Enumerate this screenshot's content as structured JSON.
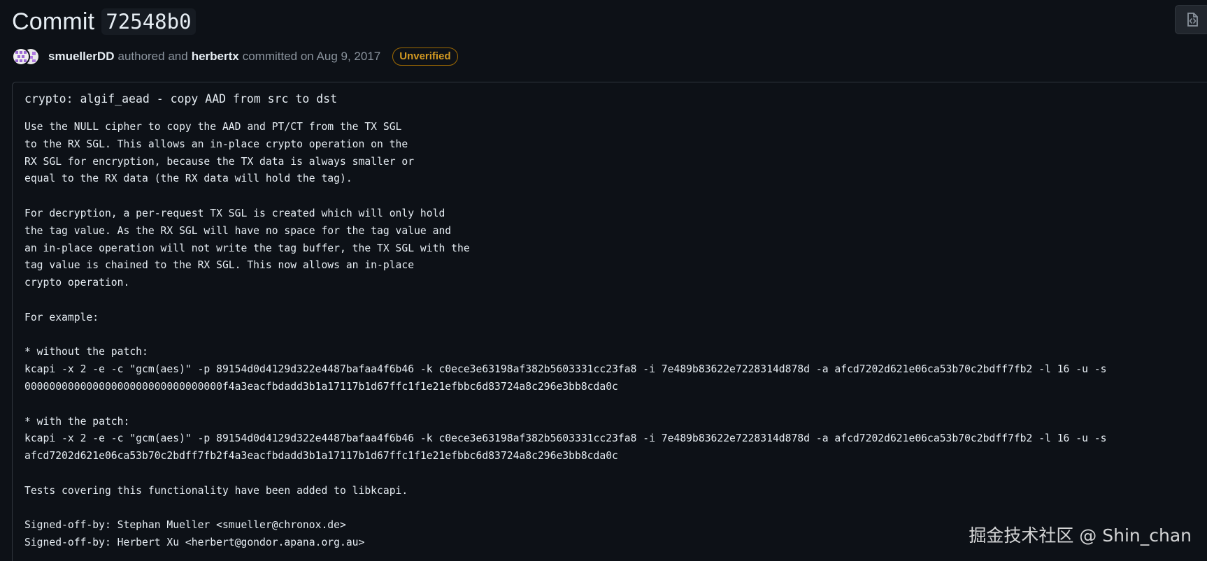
{
  "header": {
    "title": "Commit",
    "sha": "72548b0"
  },
  "meta": {
    "author": "smuellerDD",
    "authored_text": "authored and",
    "committer": "herbertx",
    "committed_text": "committed on Aug 9, 2017",
    "badge": "Unverified"
  },
  "message": {
    "title": "crypto: algif_aead - copy AAD from src to dst",
    "body": "Use the NULL cipher to copy the AAD and PT/CT from the TX SGL\nto the RX SGL. This allows an in-place crypto operation on the\nRX SGL for encryption, because the TX data is always smaller or\nequal to the RX data (the RX data will hold the tag).\n\nFor decryption, a per-request TX SGL is created which will only hold\nthe tag value. As the RX SGL will have no space for the tag value and\nan in-place operation will not write the tag buffer, the TX SGL with the\ntag value is chained to the RX SGL. This now allows an in-place\ncrypto operation.\n\nFor example:\n\n* without the patch:\nkcapi -x 2 -e -c \"gcm(aes)\" -p 89154d0d4129d322e4487bafaa4f6b46 -k c0ece3e63198af382b5603331cc23fa8 -i 7e489b83622e7228314d878d -a afcd7202d621e06ca53b70c2bdff7fb2 -l 16 -u -s\n00000000000000000000000000000000f4a3eacfbdadd3b1a17117b1d67ffc1f1e21efbbc6d83724a8c296e3bb8cda0c\n\n* with the patch:\nkcapi -x 2 -e -c \"gcm(aes)\" -p 89154d0d4129d322e4487bafaa4f6b46 -k c0ece3e63198af382b5603331cc23fa8 -i 7e489b83622e7228314d878d -a afcd7202d621e06ca53b70c2bdff7fb2 -l 16 -u -s\nafcd7202d621e06ca53b70c2bdff7fb2f4a3eacfbdadd3b1a17117b1d67ffc1f1e21efbbc6d83724a8c296e3bb8cda0c\n\nTests covering this functionality have been added to libkcapi.\n\nSigned-off-by: Stephan Mueller <smueller@chronox.de>\nSigned-off-by: Herbert Xu <herbert@gondor.apana.org.au>"
  },
  "watermark": "掘金技术社区 @ Shin_chan",
  "icons": {
    "top_right": "code-file-icon",
    "avatar": "avatar-pattern-icon"
  },
  "colors": {
    "background": "#0d1117",
    "text": "#e6edf3",
    "muted": "#8b949e",
    "border": "#30363d",
    "badge": "#d29922"
  }
}
